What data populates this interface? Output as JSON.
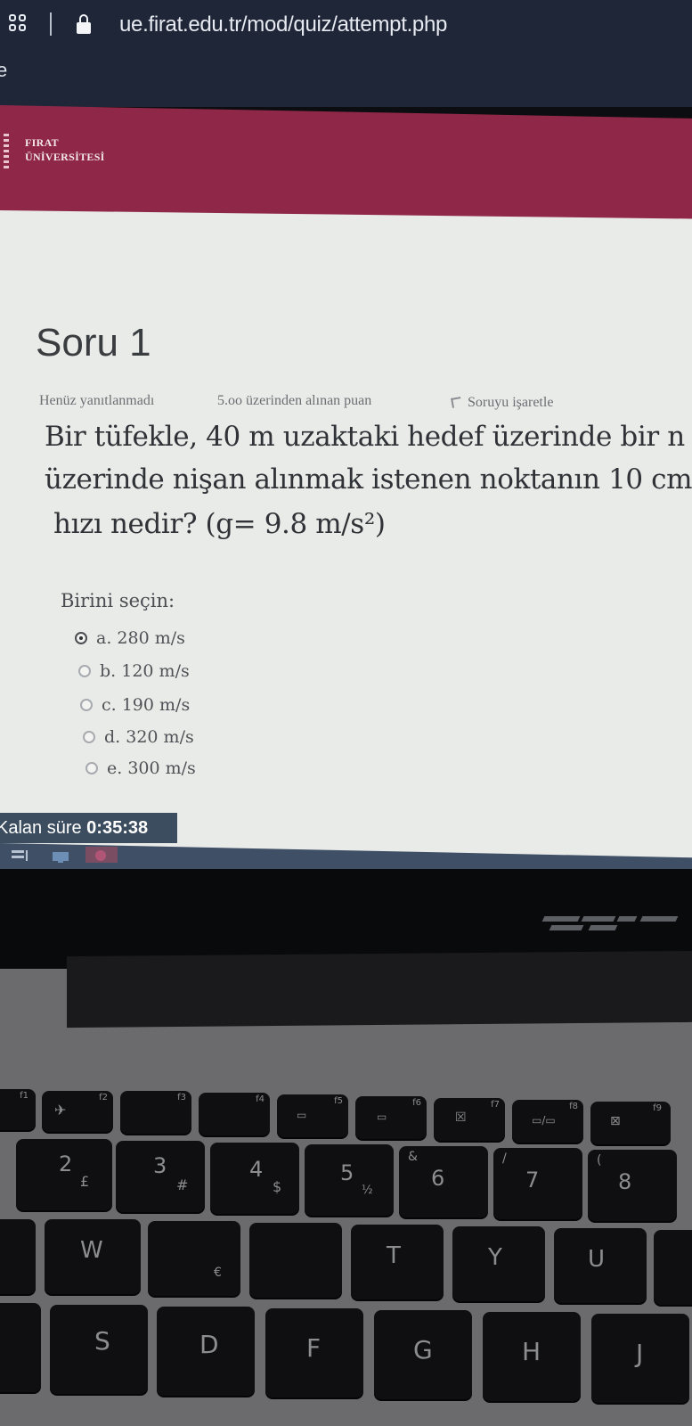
{
  "browser": {
    "url": "ue.firat.edu.tr/mod/quiz/attempt.php",
    "left_fragment": "e"
  },
  "site": {
    "logo_line1": "FIRAT",
    "logo_line2": "ÜNİVERSİTESİ"
  },
  "question": {
    "title": "Soru 1",
    "status": "Henüz yanıtlanmadı",
    "mark": "5.oo üzerinden alınan puan",
    "flag_label": "Soruyu işaretle",
    "text_lines": [
      "Bir tüfekle, 40 m uzaktaki hedef üzerinde bir n",
      "üzerinde nişan alınmak istenen noktanın 10 cm",
      "hızı nedir? (g= 9.8 m/s²)"
    ],
    "prompt": "Birini seçin:",
    "answers": [
      {
        "label": "a. 280 m/s",
        "selected": true
      },
      {
        "label": "b. 120 m/s",
        "selected": false
      },
      {
        "label": "c. 190 m/s",
        "selected": false
      },
      {
        "label": "d. 320 m/s",
        "selected": false
      },
      {
        "label": "e. 300 m/s",
        "selected": false
      }
    ]
  },
  "timer": {
    "label": "Kalan süre",
    "value": "0:35:38"
  },
  "keyboard": {
    "fn_row": [
      "f1",
      "f2",
      "f3",
      "f4",
      "f5",
      "f6",
      "f7",
      "f8",
      "f9"
    ],
    "number_row": [
      {
        "main": "2",
        "alt": "£"
      },
      {
        "main": "3",
        "alt": "#"
      },
      {
        "main": "4",
        "alt": "$"
      },
      {
        "main": "5",
        "alt": "½"
      },
      {
        "main": "6",
        "alt": "&"
      },
      {
        "main": "7",
        "alt": "/"
      },
      {
        "main": "8",
        "alt": "("
      }
    ],
    "top_row": [
      "W",
      "",
      "",
      "T",
      "Y",
      "U"
    ],
    "home_row": [
      "S",
      "D",
      "F",
      "G",
      "H",
      "J"
    ]
  }
}
